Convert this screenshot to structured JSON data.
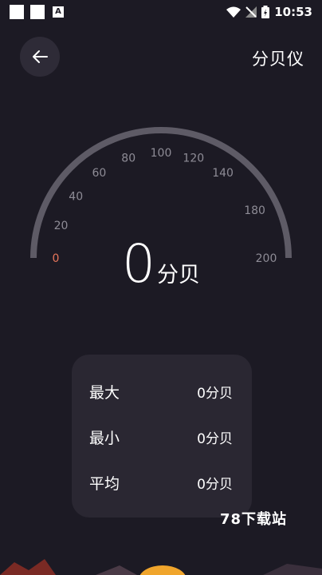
{
  "status_bar": {
    "time": "10:53",
    "notification_icon_text": "A"
  },
  "header": {
    "title": "分贝仪"
  },
  "gauge": {
    "ticks": [
      {
        "label": "0",
        "value": 0,
        "color": "#e8765b"
      },
      {
        "label": "20",
        "value": 20,
        "color": "#8e8c96"
      },
      {
        "label": "40",
        "value": 40,
        "color": "#8e8c96"
      },
      {
        "label": "60",
        "value": 60,
        "color": "#8e8c96"
      },
      {
        "label": "80",
        "value": 80,
        "color": "#8e8c96"
      },
      {
        "label": "100",
        "value": 100,
        "color": "#8e8c96"
      },
      {
        "label": "120",
        "value": 120,
        "color": "#8e8c96"
      },
      {
        "label": "140",
        "value": 140,
        "color": "#8e8c96"
      },
      {
        "label": "180",
        "value": 170,
        "color": "#8e8c96"
      },
      {
        "label": "200",
        "value": 200,
        "color": "#8e8c96"
      }
    ],
    "current_value": "0",
    "unit": "分贝"
  },
  "stats": [
    {
      "label": "最大",
      "value": "0分贝"
    },
    {
      "label": "最小",
      "value": "0分贝"
    },
    {
      "label": "平均",
      "value": "0分贝"
    }
  ],
  "watermark": "78下载站",
  "colors": {
    "background": "#1c1a24",
    "card": "#2a2732",
    "arc": "#5e5b66",
    "accent": "#e8765b"
  }
}
